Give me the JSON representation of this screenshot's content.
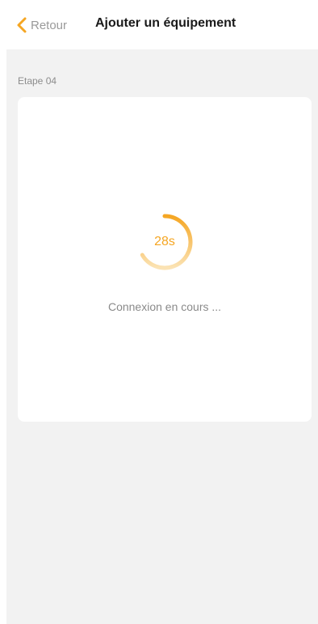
{
  "header": {
    "back_label": "Retour",
    "title": "Ajouter un équipement"
  },
  "step": {
    "label": "Etape 04"
  },
  "connection": {
    "countdown": "28s",
    "status": "Connexion en cours ..."
  },
  "colors": {
    "accent": "#f5a623",
    "background": "#f2f2f2",
    "card": "#ffffff"
  },
  "icons": {
    "back": "chevron-left-icon",
    "spinner": "progress-ring-icon"
  }
}
